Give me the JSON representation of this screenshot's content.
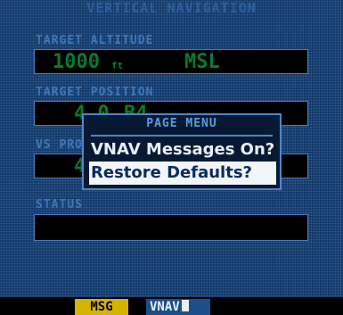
{
  "title": "VERTICAL NAVIGATION",
  "target_altitude": {
    "label": "TARGET ALTITUDE",
    "value": "1000",
    "unit": "ft",
    "reference": "MSL"
  },
  "target_position": {
    "label": "TARGET POSITION",
    "value_fragment": "4.0",
    "value_fragment_2": "B4"
  },
  "vs_profile": {
    "label": "VS PROFILE",
    "value_fragment": "4"
  },
  "status": {
    "label": "STATUS",
    "value": ""
  },
  "page_menu": {
    "title": "PAGE MENU",
    "items": [
      "VNAV Messages On?",
      "Restore Defaults?"
    ],
    "selected_index": 1
  },
  "bottom_bar": {
    "msg_label": "MSG",
    "page_label": "VNAV"
  },
  "colors": {
    "background": "#143a68",
    "field_bg": "#000000",
    "value_text": "#0a7a2e",
    "label_text": "#3f77b8",
    "msg_badge": "#d4b400",
    "menu_highlight": "#f2f6fb"
  }
}
